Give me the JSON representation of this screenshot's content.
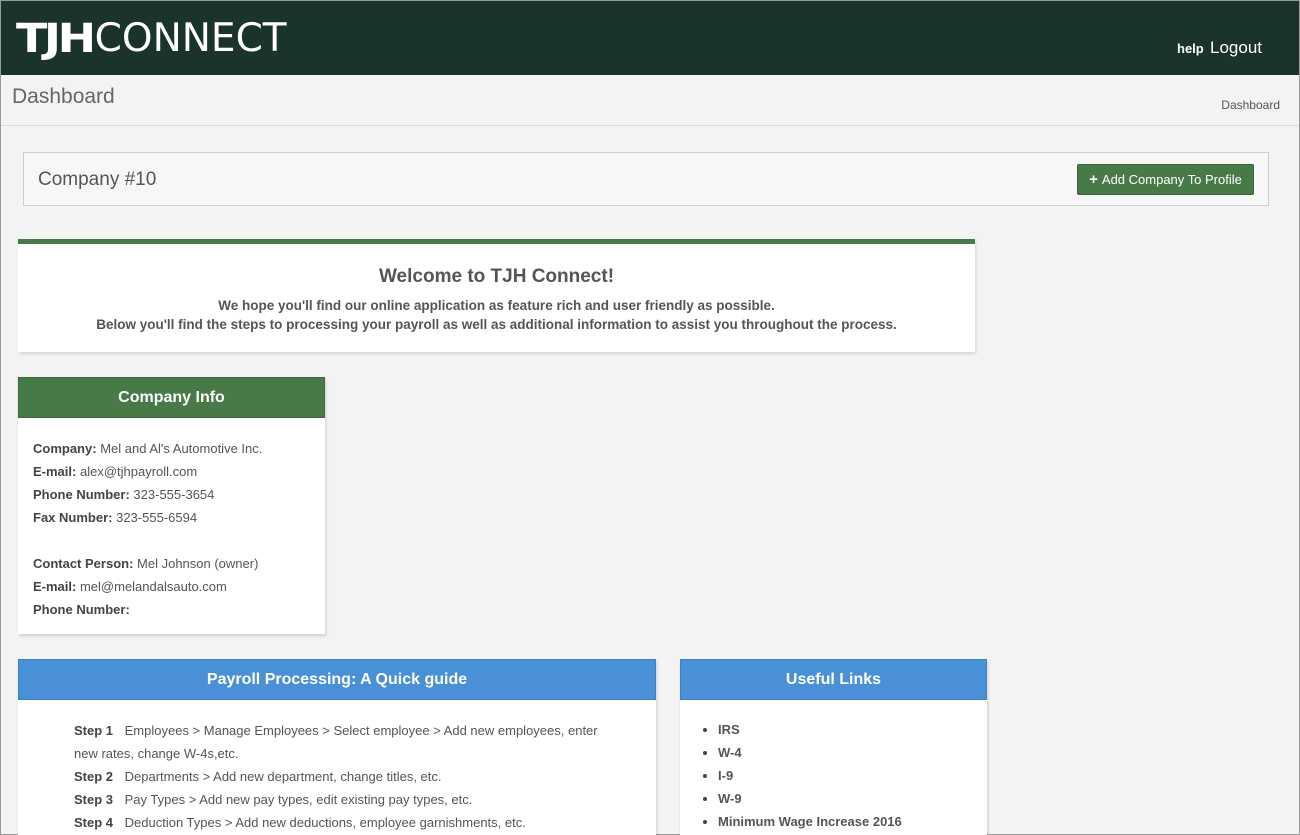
{
  "app": {
    "logo_bold": "TJH",
    "logo_thin": "CONNECT",
    "nav_help": "help",
    "nav_logout": "Logout"
  },
  "page": {
    "title": "Dashboard",
    "breadcrumb": "Dashboard"
  },
  "company_bar": {
    "name": "Company #10",
    "add_button_label": "Add Company To Profile"
  },
  "welcome": {
    "title": "Welcome to TJH Connect!",
    "line1": "We hope you'll find our online application as feature rich and user friendly as possible.",
    "line2": "Below you'll find the steps to processing your payroll as well as additional information to assist you throughout the process."
  },
  "company_info": {
    "heading": "Company Info",
    "company_label": "Company:",
    "company_value": "Mel and Al's Automotive Inc.",
    "email_label": "E-mail:",
    "email_value": "alex@tjhpayroll.com",
    "phone_label": "Phone Number:",
    "phone_value": "323-555-3654",
    "fax_label": "Fax Number:",
    "fax_value": "323-555-6594",
    "contact_label": "Contact Person:",
    "contact_value": "Mel Johnson (owner)",
    "contact_email_label": "E-mail:",
    "contact_email_value": "mel@melandalsauto.com",
    "contact_phone_label": "Phone Number:",
    "contact_phone_value": ""
  },
  "guide": {
    "heading": "Payroll Processing: A Quick guide",
    "steps": [
      {
        "label": "Step 1",
        "text": "Employees > Manage Employees > Select employee > Add new employees, enter new rates, change W-4s,etc."
      },
      {
        "label": "Step 2",
        "text": "Departments > Add new department, change titles, etc."
      },
      {
        "label": "Step 3",
        "text": "Pay Types > Add new pay types, edit existing pay types, etc."
      },
      {
        "label": "Step 4",
        "text": "Deduction Types > Add new deductions, employee garnishments, etc."
      }
    ]
  },
  "links": {
    "heading": "Useful Links",
    "items": [
      "IRS",
      "W-4",
      "I-9",
      "W-9",
      "Minimum Wage Increase 2016"
    ]
  },
  "colors": {
    "topbar": "#1b3429",
    "green": "#487a48",
    "blue": "#4a90d6"
  }
}
